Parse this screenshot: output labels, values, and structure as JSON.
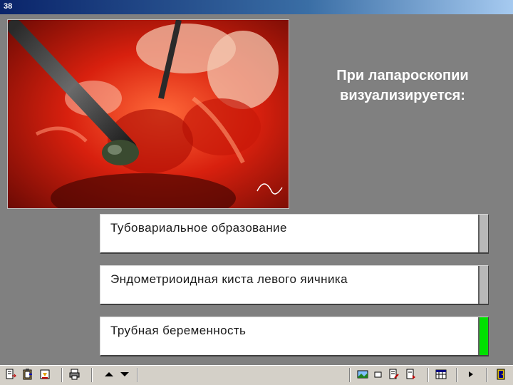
{
  "window": {
    "title": "38"
  },
  "question": "При лапароскопии визуализируется:",
  "answers": [
    {
      "label": "Тубовариальное образование",
      "indicator_color": "#b8b8b8"
    },
    {
      "label": "Эндометриоидная киста левого яичника",
      "indicator_color": "#b8b8b8"
    },
    {
      "label": "Трубная беременность",
      "indicator_color": "#00e000"
    }
  ],
  "toolbar": {
    "left_icons": [
      "document-arrow-icon",
      "clipboard-icon",
      "save-disk-icon",
      "print-icon"
    ],
    "nav_icons": [
      "arrow-up-icon",
      "arrow-down-icon"
    ],
    "right_icons": [
      "image-icon",
      "window-icon",
      "edit-page-icon",
      "note-icon",
      "calendar-icon",
      "play-icon",
      "exit-door-icon"
    ]
  },
  "colors": {
    "background": "#808080",
    "correct": "#00e000",
    "neutral": "#b8b8b8"
  }
}
